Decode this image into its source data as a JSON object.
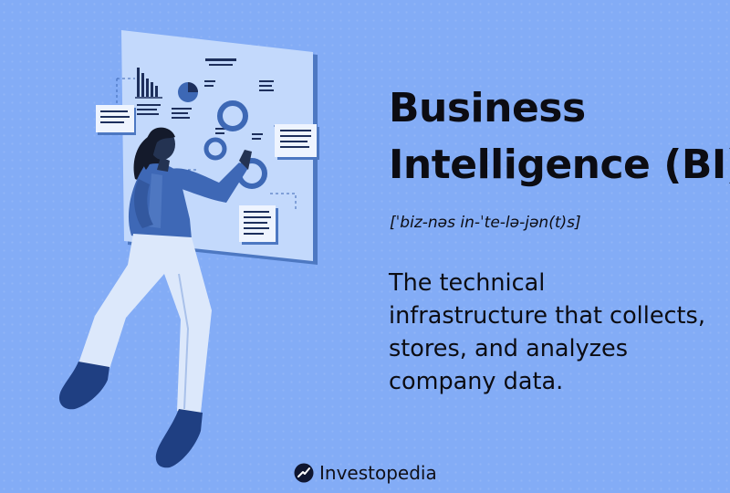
{
  "title": {
    "line1": "Business",
    "line2": "Intelligence (BI)"
  },
  "pronunciation": "[ˈbiz-nəs in-ˈte-lə-jən(t)s]",
  "definition": {
    "line1": "The technical",
    "line2": "infrastructure that collects,",
    "line3": "stores, and analyzes",
    "line4": "company data."
  },
  "brand": {
    "name": "Investopedia",
    "icon": "investopedia-logo-icon"
  },
  "colors": {
    "background": "#83acf6",
    "text": "#0c0c12",
    "panel": "#b8d2fb",
    "panel_edge": "#4d78c2",
    "accent_blue": "#3d68b5",
    "figure_jacket": "#3e68b6",
    "figure_pants": "#dce8fb",
    "figure_shoes": "#1f3f82",
    "hair": "#141a2b"
  }
}
